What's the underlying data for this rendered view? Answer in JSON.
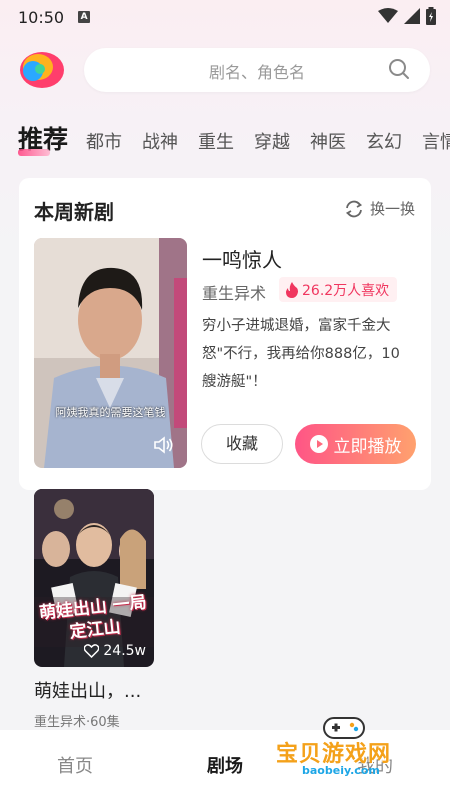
{
  "status": {
    "time": "10:50",
    "a_icon": "A"
  },
  "header": {
    "search_placeholder": "剧名、角色名"
  },
  "categories": [
    "推荐",
    "都市",
    "战神",
    "重生",
    "穿越",
    "神医",
    "玄幻",
    "言情"
  ],
  "weekly": {
    "title": "本周新剧",
    "refresh_label": "换一换",
    "drama": {
      "title": "一鸣惊人",
      "genre": "重生异术",
      "likes": "26.2万人喜欢",
      "description": "穷小子进城退婚，富家千金大怒\"不行，我再给你888亿，10艘游艇\"！",
      "subtitle": "阿姨我真的需要这笔钱",
      "collect_label": "收藏",
      "play_label": "立即播放"
    }
  },
  "grid": [
    {
      "title": "萌娃出山，...",
      "meta": "重生异术·60集",
      "likes": "24.5w",
      "cover_text": "萌娃出山 一局定江山"
    }
  ],
  "bottom_nav": [
    "首页",
    "剧场",
    "我的"
  ],
  "watermark": {
    "text": "宝贝游戏网",
    "url": "baobeiy.com"
  },
  "colors": {
    "accent": "#f0365f",
    "play_start": "#ff5586",
    "play_end": "#ffa16e"
  }
}
